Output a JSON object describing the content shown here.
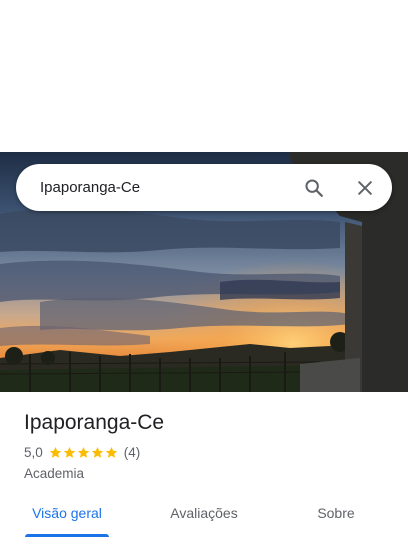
{
  "search": {
    "query": "Ipaporanga-Ce",
    "search_icon": "search-icon",
    "close_icon": "close-icon"
  },
  "hero_photo": {
    "description_icon": "photo"
  },
  "place": {
    "name": "Ipaporanga-Ce",
    "rating": "5,0",
    "rating_value": 5,
    "review_count": "(4)",
    "category": "Academia",
    "star_color": "#fbbc04"
  },
  "tabs": [
    {
      "label": "Visão geral",
      "active": true
    },
    {
      "label": "Avaliações",
      "active": false
    },
    {
      "label": "Sobre",
      "active": false
    }
  ],
  "colors": {
    "accent": "#1a73e8",
    "text_primary": "#202124",
    "text_secondary": "#5f6368"
  }
}
